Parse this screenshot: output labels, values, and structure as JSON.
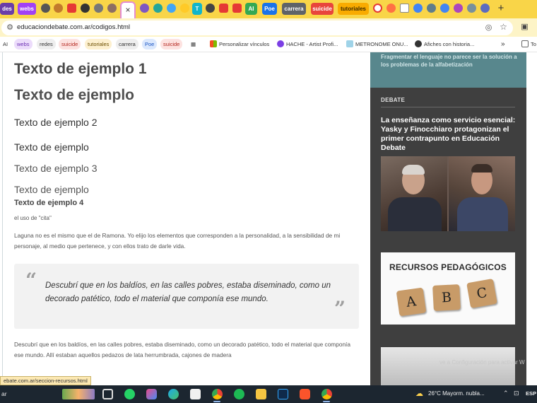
{
  "tabs": {
    "active_close": "×",
    "items": [
      {
        "label": "des",
        "color": "#6b3ea8"
      },
      {
        "label": "webs",
        "color": "#a142f4"
      },
      {
        "label": "carrera",
        "color": "#5f6368"
      },
      {
        "label": "suicide",
        "color": "#e8453c"
      },
      {
        "label": "tutoriales",
        "color": "#f9ab00"
      },
      {
        "label": "AI",
        "color": "#34a853"
      },
      {
        "label": "Poe",
        "color": "#1a73e8"
      },
      {
        "label": "T",
        "color": "#12b5cb"
      }
    ],
    "new_tab": "+"
  },
  "address_bar": {
    "url": "educaciondebate.com.ar/codigos.html"
  },
  "bookmarks": [
    {
      "label": "AI"
    },
    {
      "label": "webs"
    },
    {
      "label": "redes"
    },
    {
      "label": "suicide"
    },
    {
      "label": "tutoriales"
    },
    {
      "label": "carrera"
    },
    {
      "label": "Poe"
    },
    {
      "label": "suicide"
    },
    {
      "label": "Personalizar vínculos"
    },
    {
      "label": "HACHE - Artist Profi..."
    },
    {
      "label": "METRONOME ONU..."
    },
    {
      "label": "Afiches con historia..."
    },
    {
      "label": "»"
    },
    {
      "label": "To"
    }
  ],
  "content": {
    "h1a": "Texto de ejemplo 1",
    "h1b": "Texto de ejemplo",
    "h2a": "Texto de ejemplo 2",
    "h2b": "Texto de ejemplo",
    "h3a": "Texto de ejemplo 3",
    "h3b": "Texto de ejemplo",
    "h4a": "Texto de ejemplo 4",
    "cite": "el uso de \"cita\"",
    "para1": "Laguna no es el mismo que el de Ramona. Yo elijo los elementos que corresponden a la personalidad, a la sensibilidad de mi personaje, al medio que pertenece, y con ellos trato de darle vida.",
    "quote_open": "“",
    "quote": "Descubrí que en los baldíos, en las calles pobres, estaba diseminado, como un decorado patético, todo el material que componía ese mundo.",
    "quote_close": "”",
    "para2": "Descubrí que en los baldíos, en las calles pobres, estaba diseminado, como un decorado patético, todo el material que componía ese mundo. Allí estaban aquellos pedazos de lata herrumbrada, cajones de madera"
  },
  "sidebar": {
    "promo": "Fragmentar el lenguaje no parece ser la solución a los problemas de la alfabetización",
    "section_label": "DEBATE",
    "article_title": "La enseñanza como servicio esencial: Yasky y Finocchiaro protagonizan el primer contrapunto en Educación Debate",
    "banner_title": "RECURSOS PEDAGÓGICOS",
    "tiles": [
      "A",
      "B",
      "C"
    ]
  },
  "status_url": "ebate.com.ar/seccion-recursos.html",
  "watermark": "ve a Configuración para activar W",
  "taskbar": {
    "search_label": "ar",
    "weather": "26°C  Mayorm. nubla...",
    "lang": "ESP"
  },
  "colors": {
    "tabstrip_bg": "#f9d548",
    "sidebar_bg": "#3f3f3f",
    "promo_bg": "#58878d",
    "taskbar_bg": "#1c2630"
  }
}
